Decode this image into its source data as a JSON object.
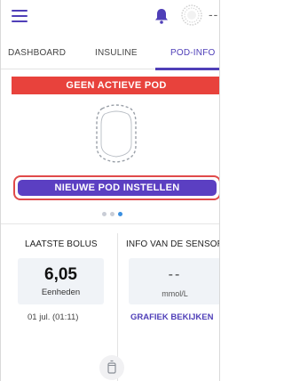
{
  "colors": {
    "accent": "#4f3fb8",
    "banner_red": "#e8423c",
    "button_purple": "#5b3fc2",
    "button_outline": "#e04a4a",
    "dot_active": "#3a8fe0",
    "value_box_bg": "#f0f3f7"
  },
  "appbar": {
    "menu_icon": "hamburger-menu-icon",
    "notification_icon": "bell-icon",
    "status_icon": "status-ring-icon",
    "overflow_text": "--"
  },
  "tabs": [
    {
      "label": "DASHBOARD",
      "active": false
    },
    {
      "label": "INSULINE",
      "active": false
    },
    {
      "label": "POD-INFO",
      "active": true
    }
  ],
  "pod": {
    "banner": "GEEN ACTIEVE POD",
    "setup_button": "NIEUWE POD INSTELLEN"
  },
  "pager": {
    "count": 3,
    "active_index": 2
  },
  "bolus": {
    "title": "LAATSTE BOLUS",
    "value": "6,05",
    "unit": "Eenheden",
    "time": "01 jul. (01:11)"
  },
  "sensor": {
    "title": "INFO VAN DE SENSOR",
    "value": "--",
    "unit": "mmol/L",
    "link": "GRAFIEK BEKIJKEN"
  }
}
